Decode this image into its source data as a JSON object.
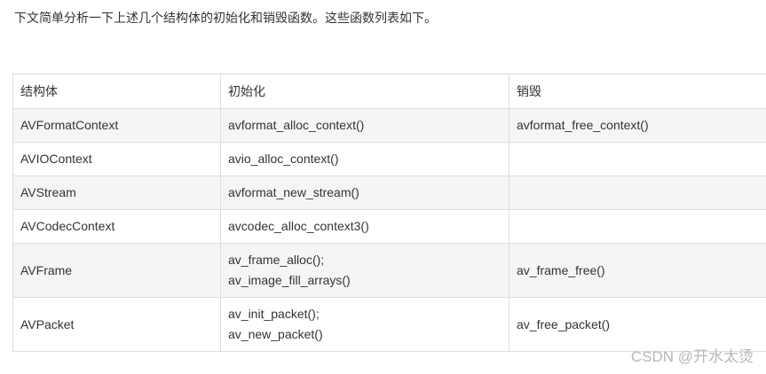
{
  "intro": "下文简单分析一下上述几个结构体的初始化和销毁函数。这些函数列表如下。",
  "table": {
    "headers": [
      "结构体",
      "初始化",
      "销毁"
    ],
    "rows": [
      {
        "struct": "AVFormatContext",
        "init": [
          "avformat_alloc_context()"
        ],
        "destroy": "avformat_free_context()"
      },
      {
        "struct": "AVIOContext",
        "init": [
          "avio_alloc_context()"
        ],
        "destroy": ""
      },
      {
        "struct": "AVStream",
        "init": [
          "avformat_new_stream()"
        ],
        "destroy": ""
      },
      {
        "struct": "AVCodecContext",
        "init": [
          "avcodec_alloc_context3()"
        ],
        "destroy": ""
      },
      {
        "struct": "AVFrame",
        "init": [
          "av_frame_alloc();",
          "av_image_fill_arrays()"
        ],
        "destroy": "av_frame_free()"
      },
      {
        "struct": "AVPacket",
        "init": [
          "av_init_packet();",
          "av_new_packet()"
        ],
        "destroy": "av_free_packet()"
      }
    ]
  },
  "watermark": "CSDN @开水太烫",
  "colors": {
    "text": "#333333",
    "border": "#dddddd",
    "row_shade": "#f5f5f5",
    "watermark": "#b7b7b7"
  }
}
